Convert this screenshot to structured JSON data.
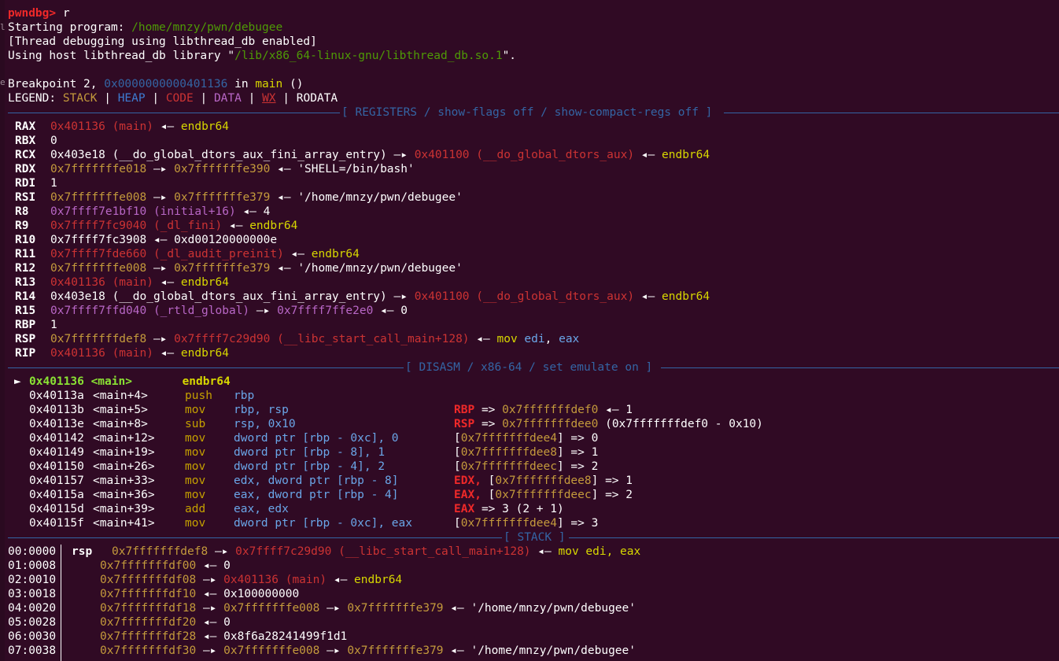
{
  "session": {
    "prompt": "pwndbg>",
    "command": "r",
    "starting_label": "Starting program:",
    "program_path": "/home/mnzy/pwn/debugee",
    "thread_msg": "[Thread debugging using libthread_db enabled]",
    "host_lib_prefix": "Using host libthread_db library \"",
    "host_lib_path": "/lib/x86_64-linux-gnu/libthread_db.so.1",
    "host_lib_suffix": "\".",
    "breakpoint_prefix": "Breakpoint 2,",
    "breakpoint_addr": "0x0000000000401136",
    "breakpoint_in": "in",
    "breakpoint_func": "main",
    "breakpoint_args": "()"
  },
  "legend": {
    "label": "LEGEND:",
    "stack": "STACK",
    "heap": "HEAP",
    "code": "CODE",
    "data": "DATA",
    "wx": "WX",
    "rodata": "RODATA",
    "sep": "|"
  },
  "sections": {
    "registers": "[ REGISTERS / show-flags off / show-compact-regs off ]",
    "disasm": "[ DISASM / x86-64 / set emulate on ]",
    "stack": "[ STACK ]"
  },
  "symbols": {
    "arrow_right": "—▸",
    "arrow_left": "◂—",
    "fat_arrow": "=>",
    "current_marker": "►"
  },
  "registers": {
    "names": [
      "RAX",
      "RBX",
      "RCX",
      "RDX",
      "RDI",
      "RSI",
      "R8",
      "R9",
      "R10",
      "R11",
      "R12",
      "R13",
      "R14",
      "R15",
      "RBP",
      "RSP",
      "RIP"
    ],
    "values": {
      "rax": [
        "0x401136 (main)",
        "endbr64"
      ],
      "rbx": "0",
      "rcx": [
        "0x403e18 (__do_global_dtors_aux_fini_array_entry)",
        "0x401100 (__do_global_dtors_aux)",
        "endbr64"
      ],
      "rdx": [
        "0x7fffffffe018",
        "0x7fffffffe390",
        "'SHELL=/bin/bash'"
      ],
      "rdi": "1",
      "rsi": [
        "0x7fffffffe008",
        "0x7fffffffe379",
        "'/home/mnzy/pwn/debugee'"
      ],
      "r8": [
        "0x7ffff7e1bf10 (initial+16)",
        "4"
      ],
      "r9": [
        "0x7ffff7fc9040 (_dl_fini)",
        "endbr64"
      ],
      "r10": [
        "0x7ffff7fc3908",
        "0xd00120000000e"
      ],
      "r11": [
        "0x7ffff7fde660 (_dl_audit_preinit)",
        "endbr64"
      ],
      "r12": [
        "0x7fffffffe008",
        "0x7fffffffe379",
        "'/home/mnzy/pwn/debugee'"
      ],
      "r13": [
        "0x401136 (main)",
        "endbr64"
      ],
      "r14": [
        "0x403e18 (__do_global_dtors_aux_fini_array_entry)",
        "0x401100 (__do_global_dtors_aux)",
        "endbr64"
      ],
      "r15": [
        "0x7ffff7ffd040 (_rtld_global)",
        "0x7ffff7ffe2e0",
        "0"
      ],
      "rbp": "1",
      "rsp": [
        "0x7fffffffdef8",
        "0x7ffff7c29d90 (__libc_start_call_main+128)",
        "mov",
        "edi",
        ",",
        "eax"
      ],
      "rip": [
        "0x401136 (main)",
        "endbr64"
      ]
    }
  },
  "disasm": [
    {
      "addr": "0x401136",
      "sym": "<main>",
      "mnem": "endbr64",
      "ops": "",
      "note": ""
    },
    {
      "addr": "0x40113a",
      "sym": "<main+4>",
      "mnem": "push",
      "ops": "rbp",
      "note": ""
    },
    {
      "addr": "0x40113b",
      "sym": "<main+5>",
      "mnem": "mov",
      "ops": "rbp, rsp",
      "note_reg": "RBP",
      "note": "0x7fffffffdef0",
      "note_tail": "1"
    },
    {
      "addr": "0x40113e",
      "sym": "<main+8>",
      "mnem": "sub",
      "ops": "rsp, 0x10",
      "note_reg": "RSP",
      "note": "0x7fffffffdee0",
      "note_tail": "(0x7fffffffdef0 - 0x10)"
    },
    {
      "addr": "0x401142",
      "sym": "<main+12>",
      "mnem": "mov",
      "ops": "dword ptr [rbp - 0xc], 0",
      "note": "0x7fffffffdee4",
      "note_tail": "0"
    },
    {
      "addr": "0x401149",
      "sym": "<main+19>",
      "mnem": "mov",
      "ops": "dword ptr [rbp - 8], 1",
      "note": "0x7fffffffdee8",
      "note_tail": "1"
    },
    {
      "addr": "0x401150",
      "sym": "<main+26>",
      "mnem": "mov",
      "ops": "dword ptr [rbp - 4], 2",
      "note": "0x7fffffffdeec",
      "note_tail": "2"
    },
    {
      "addr": "0x401157",
      "sym": "<main+33>",
      "mnem": "mov",
      "ops": "edx, dword ptr [rbp - 8]",
      "note_reg": "EDX,",
      "note": "0x7fffffffdee8",
      "note_tail": "1"
    },
    {
      "addr": "0x40115a",
      "sym": "<main+36>",
      "mnem": "mov",
      "ops": "eax, dword ptr [rbp - 4]",
      "note_reg": "EAX,",
      "note": "0x7fffffffdeec",
      "note_tail": "2"
    },
    {
      "addr": "0x40115d",
      "sym": "<main+39>",
      "mnem": "add",
      "ops": "eax, edx",
      "note_reg": "EAX",
      "note_tail": "3 (2 + 1)"
    },
    {
      "addr": "0x40115f",
      "sym": "<main+41>",
      "mnem": "mov",
      "ops": "dword ptr [rbp - 0xc], eax",
      "note": "0x7fffffffdee4",
      "note_tail": "3"
    }
  ],
  "stack": [
    {
      "idx": "00:0000",
      "reg": "rsp",
      "addr": "0x7fffffffdef8",
      "chain": [
        "0x7ffff7c29d90 (__libc_start_call_main+128)",
        "mov edi, eax"
      ]
    },
    {
      "idx": "01:0008",
      "reg": "",
      "addr": "0x7fffffffdf00",
      "chain": [
        "0"
      ]
    },
    {
      "idx": "02:0010",
      "reg": "",
      "addr": "0x7fffffffdf08",
      "chain": [
        "0x401136 (main)",
        "endbr64"
      ]
    },
    {
      "idx": "03:0018",
      "reg": "",
      "addr": "0x7fffffffdf10",
      "chain": [
        "0x100000000"
      ]
    },
    {
      "idx": "04:0020",
      "reg": "",
      "addr": "0x7fffffffdf18",
      "chain": [
        "0x7fffffffe008",
        "0x7fffffffe379",
        "'/home/mnzy/pwn/debugee'"
      ]
    },
    {
      "idx": "05:0028",
      "reg": "",
      "addr": "0x7fffffffdf20",
      "chain": [
        "0"
      ]
    },
    {
      "idx": "06:0030",
      "reg": "",
      "addr": "0x7fffffffdf28",
      "chain": [
        "0x8f6a28241499f1d1"
      ]
    },
    {
      "idx": "07:0038",
      "reg": "",
      "addr": "0x7fffffffdf30",
      "chain": [
        "0x7fffffffe008",
        "0x7fffffffe379",
        "'/home/mnzy/pwn/debugee'"
      ]
    }
  ],
  "edge_fragments": [
    "ls",
    "e"
  ],
  "colors": {
    "background": "#300a24",
    "prompt": "#cc0000",
    "stack_color": "#c49a3c",
    "code_color": "#cc3333",
    "data_color": "#b867c6",
    "heap_color": "#3d7bd1",
    "section_rule": "#3465a4",
    "mnemonic": "#c4a000",
    "current_line": "#8ae234"
  }
}
